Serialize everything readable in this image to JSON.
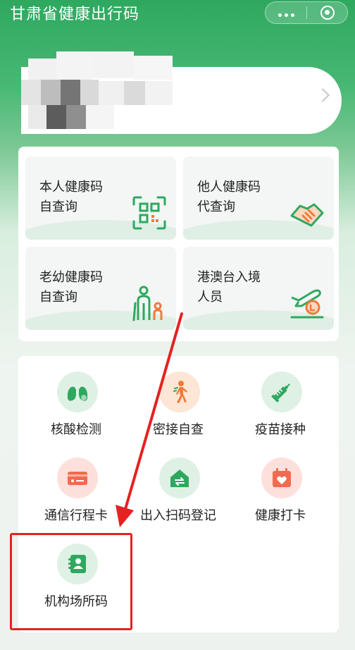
{
  "header": {
    "title": "甘肃省健康出行码"
  },
  "user_card": {
    "avatar": "blurred-avatar",
    "chevron": "chevron-right-icon"
  },
  "code_cards": [
    {
      "line1": "本人健康码",
      "line2": "自查询",
      "icon": "qr-scan-icon"
    },
    {
      "line1": "他人健康码",
      "line2": "代查询",
      "icon": "handshake-icon"
    },
    {
      "line1": "老幼健康码",
      "line2": "自查询",
      "icon": "elder-child-icon"
    },
    {
      "line1": "港澳台入境",
      "line2": "人员",
      "icon": "plane-landing-icon"
    }
  ],
  "services": [
    {
      "label": "核酸检测",
      "icon": "lungs-icon"
    },
    {
      "label": "密接自查",
      "icon": "walking-person-icon"
    },
    {
      "label": "疫苗接种",
      "icon": "syringe-icon"
    },
    {
      "label": "通信行程卡",
      "icon": "card-icon"
    },
    {
      "label": "出入扫码登记",
      "icon": "home-scan-icon"
    },
    {
      "label": "健康打卡",
      "icon": "calendar-check-icon"
    },
    {
      "label": "机构场所码",
      "icon": "contact-book-icon"
    }
  ],
  "colors": {
    "brand_green": "#2fa85f",
    "accent_orange": "#f07a3a",
    "highlight_red": "#e52222"
  }
}
